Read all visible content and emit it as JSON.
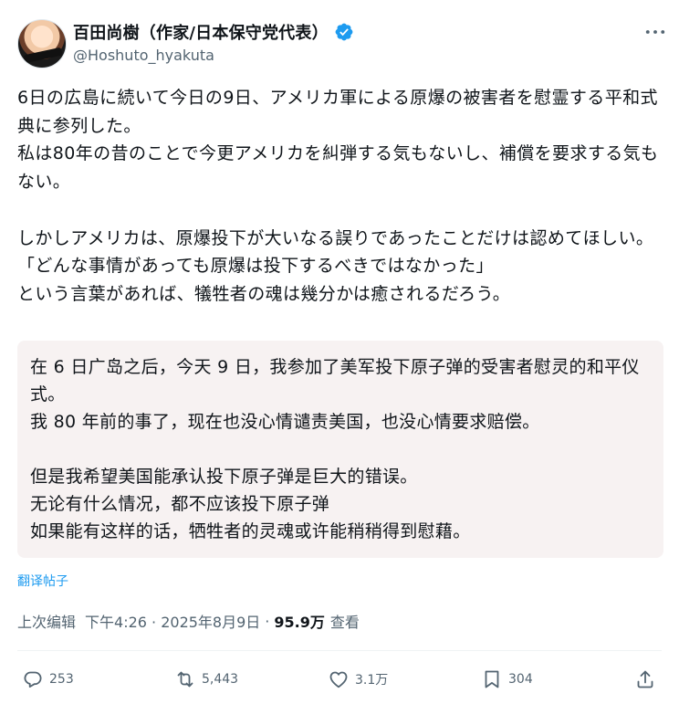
{
  "author": {
    "display_name": "百田尚樹（作家/日本保守党代表）",
    "handle": "@Hoshuto_hyakuta"
  },
  "tweet": {
    "text": "6日の広島に続いて今日の9日、アメリカ軍による原爆の被害者を慰霊する平和式典に参列した。\n私は80年の昔のことで今更アメリカを糾弾する気もないし、補償を要求する気もない。\n\nしかしアメリカは、原爆投下が大いなる誤りであったことだけは認めてほしい。\n「どんな事情があっても原爆は投下するべきではなかった」\nという言葉があれば、犠牲者の魂は幾分かは癒されるだろう。"
  },
  "translation": {
    "text": "在 6 日广岛之后，今天 9 日，我参加了美军投下原子弹的受害者慰灵的和平仪式。\n我 80 年前的事了，现在也没心情谴责美国，也没心情要求赔偿。\n\n但是我希望美国能承认投下原子弹是巨大的错误。\n无论有什么情况，都不应该投下原子弹\n如果能有这样的话，牺牲者的灵魂或许能稍稍得到慰藉。",
    "link_label": "翻译帖子"
  },
  "meta": {
    "edited_label": "上次编辑",
    "timestamp": "下午4:26 · 2025年8月9日",
    "views_count": "95.9万",
    "views_label": "查看"
  },
  "actions": {
    "replies": "253",
    "reposts": "5,443",
    "likes": "3.1万",
    "bookmarks": "304"
  },
  "colors": {
    "accent": "#1d9bf0",
    "muted": "#536471",
    "translation_bg": "#f7f2f2"
  },
  "icons": [
    "verified-badge-icon",
    "more-icon",
    "reply-icon",
    "repost-icon",
    "like-icon",
    "bookmark-icon",
    "share-icon"
  ]
}
